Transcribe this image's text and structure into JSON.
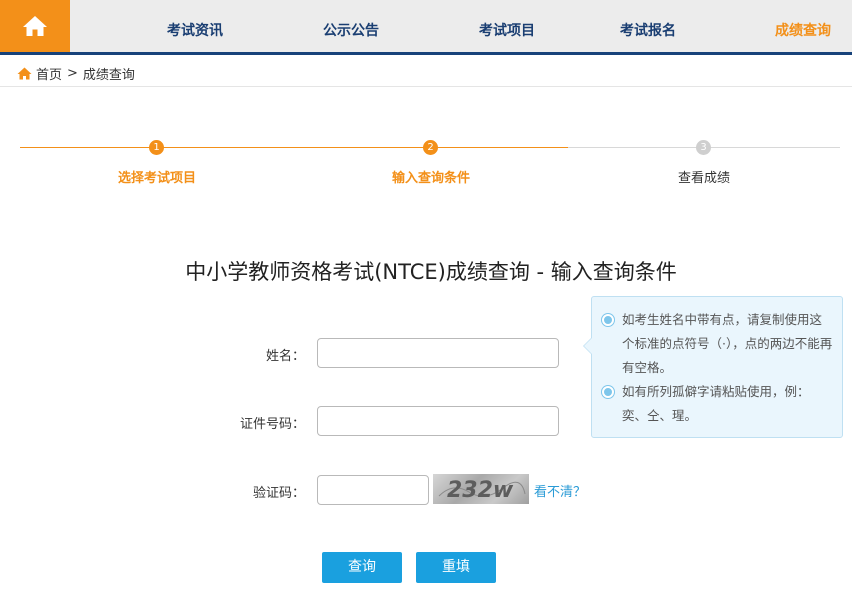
{
  "nav": {
    "home_icon": "home-icon",
    "items": [
      {
        "label": "考试资讯"
      },
      {
        "label": "公示公告"
      },
      {
        "label": "考试项目"
      },
      {
        "label": "考试报名"
      },
      {
        "label": "成绩查询",
        "active": true
      }
    ],
    "colors": {
      "accent": "#f39019",
      "nav_text": "#1a3e72",
      "nav_bg": "#ececec",
      "border": "#17427a"
    }
  },
  "breadcrumb": {
    "home_label": "首页",
    "separator": ">",
    "current": "成绩查询"
  },
  "steps": [
    {
      "number": "1",
      "label": "选择考试项目",
      "state": "done"
    },
    {
      "number": "2",
      "label": "输入查询条件",
      "state": "current"
    },
    {
      "number": "3",
      "label": "查看成绩",
      "state": "todo"
    }
  ],
  "title": "中小学教师资格考试(NTCE)成绩查询 - 输入查询条件",
  "form": {
    "name_label": "姓名：",
    "name_value": "",
    "id_label": "证件号码：",
    "id_value": "",
    "captcha_label": "验证码：",
    "captcha_value": "",
    "captcha_image_text": "232w",
    "captcha_refresh": "看不清？"
  },
  "tips": [
    "如考生姓名中带有点，请复制使用这个标准的点符号（·），点的两边不能再有空格。",
    "如有所列孤僻字请粘贴使用，例：奕、仝、瑆。"
  ],
  "buttons": {
    "query": "查询",
    "reset": "重填",
    "color": "#1aa0df"
  }
}
